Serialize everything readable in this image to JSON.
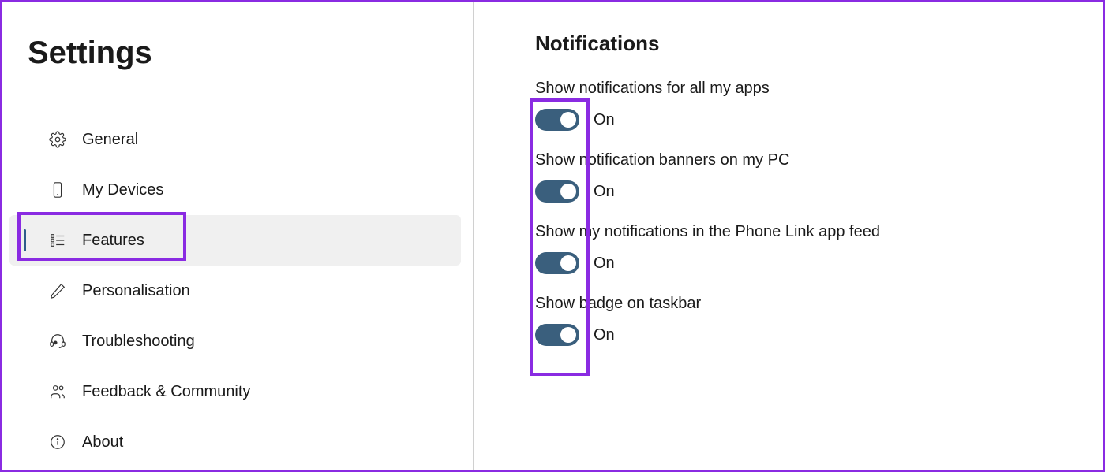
{
  "sidebar": {
    "title": "Settings",
    "items": [
      {
        "id": "general",
        "label": "General",
        "active": false
      },
      {
        "id": "my-devices",
        "label": "My Devices",
        "active": false
      },
      {
        "id": "features",
        "label": "Features",
        "active": true
      },
      {
        "id": "personalisation",
        "label": "Personalisation",
        "active": false
      },
      {
        "id": "troubleshooting",
        "label": "Troubleshooting",
        "active": false
      },
      {
        "id": "feedback-community",
        "label": "Feedback & Community",
        "active": false
      },
      {
        "id": "about",
        "label": "About",
        "active": false
      }
    ]
  },
  "main": {
    "section_title": "Notifications",
    "settings": [
      {
        "id": "show-all-apps",
        "label": "Show notifications for all my apps",
        "state": "On",
        "on": true
      },
      {
        "id": "show-banners",
        "label": "Show notification banners on my PC",
        "state": "On",
        "on": true
      },
      {
        "id": "show-feed",
        "label": "Show my notifications in the Phone Link app feed",
        "state": "On",
        "on": true
      },
      {
        "id": "badge-taskbar",
        "label": "Show badge on taskbar",
        "state": "On",
        "on": true
      }
    ]
  },
  "annotations": {
    "highlight_sidebar_item": "features",
    "highlight_toggles_column": true
  }
}
